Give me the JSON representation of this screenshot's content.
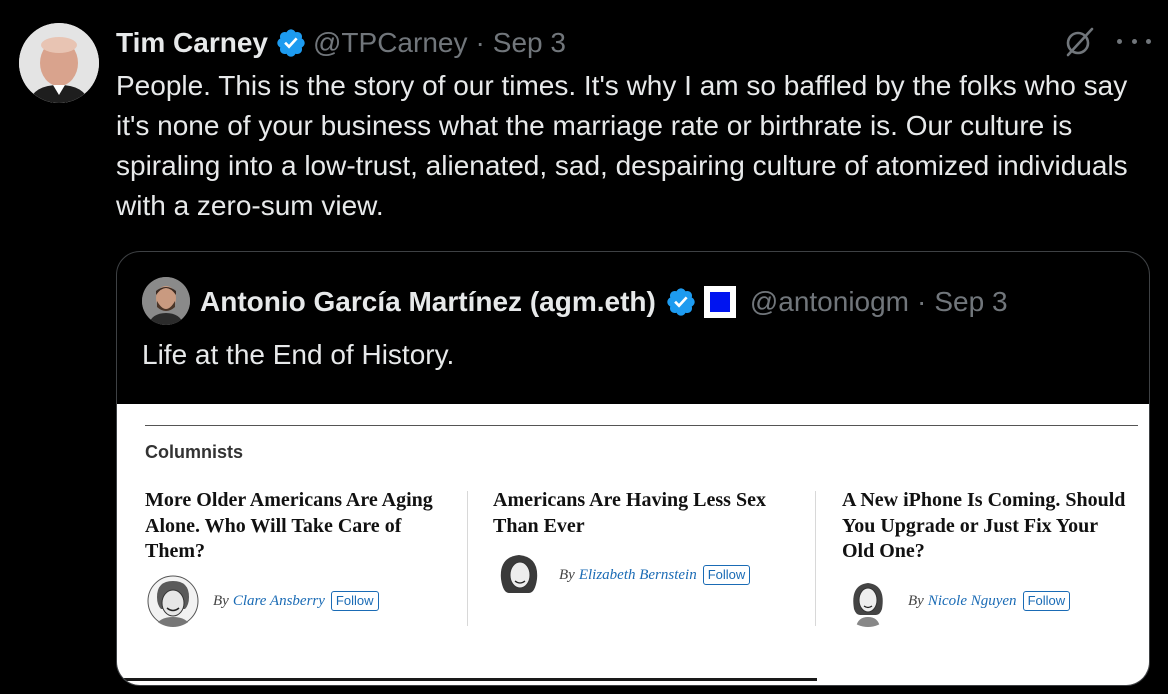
{
  "tweet": {
    "author_name": "Tim Carney",
    "handle": "@TPCarney",
    "separator": "·",
    "time": "Sep 3",
    "text": "People. This is the story of our times. It's why I am so baffled by the folks who say it's none of your business what the marriage rate or birthrate is. Our culture is spiraling into a low-trust, alienated, sad, despairing culture of atomized individuals with a zero-sum view.",
    "grok_icon": "grok-icon",
    "more_icon": "more-icon"
  },
  "quote": {
    "author_name": "Antonio García Martínez (agm.eth)",
    "handle": "@antoniogm",
    "separator": "·",
    "time": "Sep 3",
    "text": "Life at the End of History.",
    "badge_icon": "blue-square-badge-icon"
  },
  "article": {
    "section": "Columnists",
    "columns": [
      {
        "headline": "More Older Americans Are Aging Alone. Who Will Take Care of Them?",
        "by": "By",
        "author": "Clare Ansberry",
        "follow": "Follow"
      },
      {
        "headline": "Americans Are Having Less Sex Than Ever",
        "by": "By",
        "author": "Elizabeth Bernstein",
        "follow": "Follow"
      },
      {
        "headline": "A New iPhone Is Coming. Should You Upgrade or Just Fix Your Old One?",
        "by": "By",
        "author": "Nicole Nguyen",
        "follow": "Follow"
      }
    ]
  },
  "colors": {
    "verified": "#1d9bf0",
    "link": "#1a6bb5",
    "muted": "#71767b"
  }
}
